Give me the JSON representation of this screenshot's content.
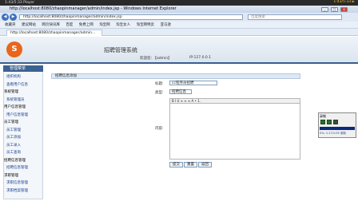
{
  "player": {
    "title": "1:43/5:33 Player",
    "right_text": "1:43/5:33 ►"
  },
  "browser": {
    "window_title": "http://localhost:8080/zhaopinmanager/admin/index.jsp - Windows Internet Explorer",
    "address": "http://localhost:8080/zhaopinmanager/admin/index.jsp",
    "search_placeholder": "百度搜索",
    "tab_label": "http://localhost:8080/zhaopinmanager/admin...",
    "favorites": [
      "收藏夹",
      "建议网站",
      "网页快讯库",
      "百度",
      "免费上网",
      "淘宝网",
      "淘宝女人",
      "淘宝网特卖",
      "亚马逊"
    ]
  },
  "app": {
    "system_title": "招聘管理系统",
    "welcome": "欢迎您: 【admin】",
    "ip": "IP:127.0.0.1",
    "logo_glyph": "S"
  },
  "menu": {
    "title": "管理菜单",
    "entries": [
      {
        "label": "组织机构",
        "kind": "item"
      },
      {
        "label": "查看用户信息",
        "kind": "item"
      },
      {
        "label": "系统管理",
        "kind": "group"
      },
      {
        "label": "系统管理员",
        "kind": "item"
      },
      {
        "label": "用户信息管理",
        "kind": "group"
      },
      {
        "label": "用户信息管理",
        "kind": "item"
      },
      {
        "label": "员工管理",
        "kind": "group"
      },
      {
        "label": "员工管理",
        "kind": "item"
      },
      {
        "label": "员工添加",
        "kind": "item"
      },
      {
        "label": "员工录入",
        "kind": "item"
      },
      {
        "label": "员工查询",
        "kind": "item"
      },
      {
        "label": "招聘信息管理",
        "kind": "group"
      },
      {
        "label": "招聘信息管理",
        "kind": "item"
      },
      {
        "label": "求职管理",
        "kind": "group"
      },
      {
        "label": "求职信息管理",
        "kind": "item"
      },
      {
        "label": "求职档案管理",
        "kind": "item"
      }
    ]
  },
  "form": {
    "header": "招聘信息添加",
    "title_label": "标题:",
    "title_value": "cc程序员招聘",
    "type_label": "类型:",
    "type_value": "招聘信息",
    "content_label": "内容:",
    "editor_toolbar": "B I U  ≡ ≡ ≡  A  •  1.",
    "buttons": [
      "提交",
      "重置",
      "返回"
    ]
  },
  "recorder": {
    "title": "录制",
    "status": "0%: 1:17/1:05 录制"
  }
}
